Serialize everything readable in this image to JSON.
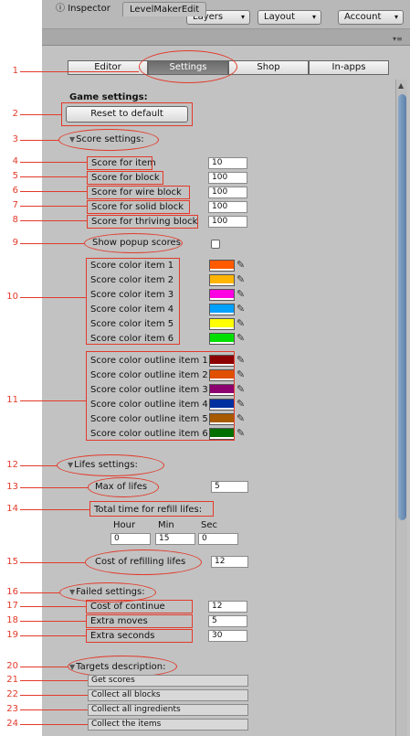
{
  "toolbar": {
    "layers_label": "Layers",
    "layout_label": "Layout",
    "account_label": "Account",
    "arrow": "▾"
  },
  "tabs": {
    "inspector_label": "Inspector",
    "inspector_icon": "ⓘ",
    "level_label": "LevelMakerEdit",
    "menu_icon": "▾≡"
  },
  "segments": [
    "Editor",
    "Settings",
    "Shop",
    "In-apps"
  ],
  "game_settings_title": "Game settings:",
  "reset_label": "Reset to default",
  "score_settings_title": "Score settings:",
  "score_fields": [
    {
      "label": "Score for item",
      "value": "10"
    },
    {
      "label": "Score for block",
      "value": "100"
    },
    {
      "label": "Score for wire block",
      "value": "100"
    },
    {
      "label": "Score for solid block",
      "value": "100"
    },
    {
      "label": "Score for thriving block",
      "value": "100"
    }
  ],
  "popup_label": "Show popup scores",
  "score_colors": [
    {
      "label": "Score color item 1",
      "color": "#ff5a00"
    },
    {
      "label": "Score color item 2",
      "color": "#ffb400"
    },
    {
      "label": "Score color item 3",
      "color": "#ff00e0"
    },
    {
      "label": "Score color item 4",
      "color": "#00a0ff"
    },
    {
      "label": "Score color item 5",
      "color": "#ffff00"
    },
    {
      "label": "Score color item 6",
      "color": "#00e000"
    }
  ],
  "outline_colors": [
    {
      "label": "Score color outline item 1",
      "color": "#8c0000"
    },
    {
      "label": "Score color outline item 2",
      "color": "#e05000"
    },
    {
      "label": "Score color outline item 3",
      "color": "#8c0070"
    },
    {
      "label": "Score color outline item 4",
      "color": "#0030a0"
    },
    {
      "label": "Score color outline item 5",
      "color": "#a85a00"
    },
    {
      "label": "Score color outline item 6",
      "color": "#007000"
    }
  ],
  "lifes_settings_title": "Lifes settings:",
  "max_lifes": {
    "label": "Max of lifes",
    "value": "5"
  },
  "refill": {
    "label": "Total time for refill lifes:",
    "hour_label": "Hour",
    "min_label": "Min",
    "sec_label": "Sec",
    "hour": "0",
    "min": "15",
    "sec": "0"
  },
  "refill_cost": {
    "label": "Cost of refilling lifes",
    "value": "12"
  },
  "failed_settings_title": "Failed settings:",
  "failed_fields": [
    {
      "label": "Cost of continue",
      "value": "12"
    },
    {
      "label": "Extra moves",
      "value": "5"
    },
    {
      "label": "Extra seconds",
      "value": "30"
    }
  ],
  "targets_title": "Targets description:",
  "targets": [
    "Get scores",
    "Collect all blocks",
    "Collect all ingredients",
    "Collect the items"
  ],
  "numbers": [
    "1",
    "2",
    "3",
    "4",
    "5",
    "6",
    "7",
    "8",
    "9",
    "10",
    "11",
    "12",
    "13",
    "14",
    "15",
    "16",
    "17",
    "18",
    "19",
    "20",
    "21",
    "22",
    "23",
    "24"
  ],
  "picker_icon": "✎",
  "section_triangle": "▼",
  "scroll_up": "▲"
}
